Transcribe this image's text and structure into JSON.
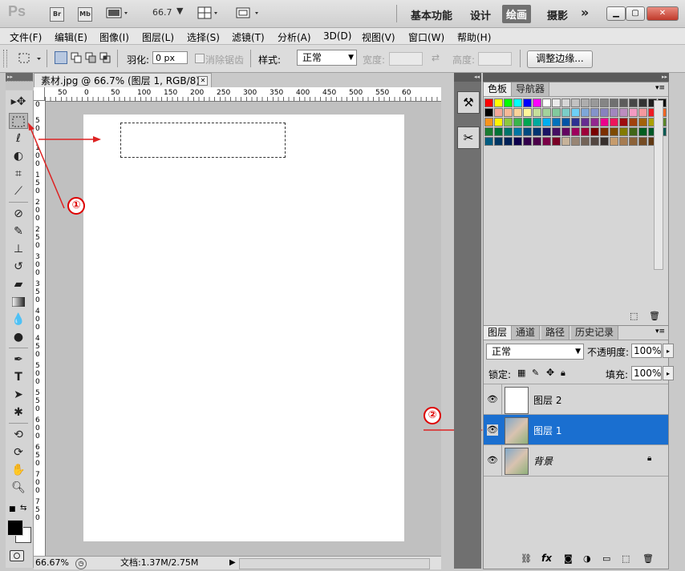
{
  "titlebar": {
    "logo": "Ps",
    "br": "Br",
    "mb": "Mb",
    "zoom": "66.7",
    "workspaces": [
      "基本功能",
      "设计",
      "绘画",
      "摄影"
    ],
    "more": "»"
  },
  "menu": [
    "文件(F)",
    "编辑(E)",
    "图像(I)",
    "图层(L)",
    "选择(S)",
    "滤镜(T)",
    "分析(A)",
    "3D(D)",
    "视图(V)",
    "窗口(W)",
    "帮助(H)"
  ],
  "options": {
    "feather_label": "羽化:",
    "feather_value": "0 px",
    "antialias_label": "消除锯齿",
    "style_label": "样式:",
    "style_value": "正常",
    "width_label": "宽度:",
    "height_label": "高度:",
    "refine_button": "调整边缘..."
  },
  "document": {
    "tab_title": "素材.jpg @ 66.7% (图层 1, RGB/8) *",
    "ruler_h": [
      "50",
      "0",
      "50",
      "100",
      "150",
      "200",
      "250",
      "300",
      "350",
      "400",
      "450",
      "500",
      "550",
      "60"
    ],
    "ruler_v": [
      [
        "0"
      ],
      [
        "5",
        "0"
      ],
      [
        "1",
        "0",
        "0"
      ],
      [
        "1",
        "5",
        "0"
      ],
      [
        "2",
        "0",
        "0"
      ],
      [
        "2",
        "5",
        "0"
      ],
      [
        "3",
        "0",
        "0"
      ],
      [
        "3",
        "5",
        "0"
      ],
      [
        "4",
        "0",
        "0"
      ],
      [
        "4",
        "5",
        "0"
      ],
      [
        "5",
        "0",
        "0"
      ],
      [
        "5",
        "5",
        "0"
      ],
      [
        "6",
        "0",
        "0"
      ],
      [
        "6",
        "5",
        "0"
      ],
      [
        "7",
        "0",
        "0"
      ],
      [
        "7",
        "5",
        "0"
      ]
    ],
    "zoom_status": "66.67%",
    "file_status": "文档:1.37M/2.75M"
  },
  "swatches_panel": {
    "tabs": [
      "色板",
      "导航器"
    ],
    "rows": [
      [
        "#ff0000",
        "#ffff00",
        "#00ff00",
        "#00ffff",
        "#0000ff",
        "#ff00ff",
        "#ffffff",
        "#ebebeb",
        "#d6d6d6",
        "#c2c2c2",
        "#adadad",
        "#999999",
        "#858585",
        "#707070",
        "#5c5c5c",
        "#474747",
        "#333333",
        "#1f1f1f",
        "#0a0a0a",
        "#000000"
      ],
      [
        "#f4a79a",
        "#f7b896",
        "#fbd399",
        "#fff79a",
        "#c5df9b",
        "#a3d39c",
        "#82ca9d",
        "#7bcdc8",
        "#6ecff6",
        "#7ea7d8",
        "#8493ca",
        "#8882be",
        "#a187be",
        "#bc8dbf",
        "#f49ac2",
        "#f6989d",
        "#ed1c24",
        "#f26522",
        "#f7941d",
        "#fff200"
      ],
      [
        "#8dc73f",
        "#39b54a",
        "#00a651",
        "#00a99d",
        "#00aeef",
        "#0072bc",
        "#0054a6",
        "#2e3192",
        "#662d91",
        "#92278f",
        "#ec008c",
        "#ed145b",
        "#9e0b0f",
        "#a0410d",
        "#a3620a",
        "#aba000",
        "#598527",
        "#197b30",
        "#007236",
        "#00746b"
      ],
      [
        "#0076a3",
        "#004a80",
        "#003471",
        "#1b1464",
        "#440e62",
        "#630460",
        "#9e005d",
        "#9e0039",
        "#790000",
        "#7b2e00",
        "#7d4900",
        "#827b00",
        "#406618",
        "#005e20",
        "#005826",
        "#005952",
        "#005b7f",
        "#003663",
        "#002157",
        "#0d004c"
      ],
      [
        "#32004b",
        "#4b0049",
        "#7b0046",
        "#7a0026",
        "#c7b299",
        "#998675",
        "#736357",
        "#534741",
        "#37302d",
        "#c69c6d",
        "#a67c52",
        "#8c6239",
        "#754c24",
        "#603913"
      ]
    ]
  },
  "layers_panel": {
    "tabs": [
      "图层",
      "通道",
      "路径",
      "历史记录"
    ],
    "blend_mode": "正常",
    "opacity_label": "不透明度:",
    "opacity_value": "100%",
    "lock_label": "锁定:",
    "fill_label": "填充:",
    "fill_value": "100%",
    "layers": [
      {
        "name": "图层 2",
        "selected": false
      },
      {
        "name": "图层 1",
        "selected": true
      },
      {
        "name": "背景",
        "selected": false
      }
    ]
  },
  "annotations": [
    "①",
    "②"
  ],
  "colors": {
    "selection_blue": "#1a6fd0",
    "annotation_red": "#dd0000"
  }
}
